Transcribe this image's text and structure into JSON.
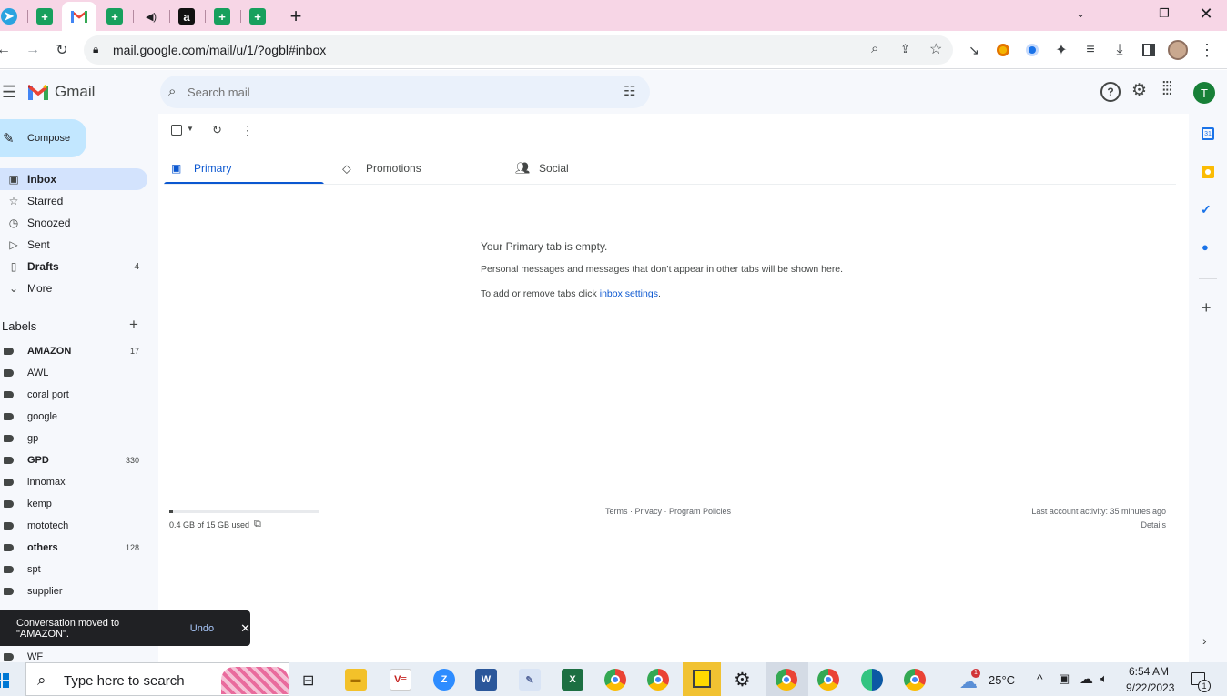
{
  "browser": {
    "tabs": [
      {
        "icon": "telegram-icon",
        "color": "#2aa3e0",
        "glyph": "➤",
        "active": false
      },
      {
        "icon": "sheets-icon",
        "color": "#17a05d",
        "glyph": "+",
        "active": false
      },
      {
        "icon": "gmail-icon",
        "color": "#ea4335",
        "glyph": "M",
        "active": true
      },
      {
        "icon": "sheets-icon",
        "color": "#17a05d",
        "glyph": "+",
        "active": false
      },
      {
        "icon": "audio-icon",
        "color": "#202124",
        "glyph": "◀",
        "active": false
      },
      {
        "icon": "amazon-icon",
        "color": "#111111",
        "glyph": "a",
        "active": false
      },
      {
        "icon": "sheets-icon",
        "color": "#17a05d",
        "glyph": "+",
        "active": false
      },
      {
        "icon": "sheets-icon",
        "color": "#17a05d",
        "glyph": "+",
        "active": false
      }
    ],
    "new_tab": "+",
    "url": "mail.google.com/mail/u/1/?ogbl#inbox"
  },
  "gmail": {
    "logo": "Gmail",
    "search_placeholder": "Search mail",
    "avatar_letter": "T",
    "compose": "Compose",
    "nav": [
      {
        "icon": "inbox-icon",
        "glyph": "▣",
        "label": "Inbox",
        "count": "",
        "bold": true,
        "selected": true
      },
      {
        "icon": "star-icon",
        "glyph": "☆",
        "label": "Starred",
        "count": "",
        "bold": false,
        "selected": false
      },
      {
        "icon": "clock-icon",
        "glyph": "◷",
        "label": "Snoozed",
        "count": "",
        "bold": false,
        "selected": false
      },
      {
        "icon": "send-icon",
        "glyph": "▷",
        "label": "Sent",
        "count": "",
        "bold": false,
        "selected": false
      },
      {
        "icon": "draft-icon",
        "glyph": "▯",
        "label": "Drafts",
        "count": "4",
        "bold": true,
        "selected": false
      },
      {
        "icon": "chevron-down-icon",
        "glyph": "⌄",
        "label": "More",
        "count": "",
        "bold": false,
        "selected": false
      }
    ],
    "labels_heading": "Labels",
    "labels": [
      {
        "label": "AMAZON",
        "count": "17",
        "bold": true
      },
      {
        "label": "AWL",
        "count": "",
        "bold": false
      },
      {
        "label": "coral port",
        "count": "",
        "bold": false
      },
      {
        "label": "google",
        "count": "",
        "bold": false
      },
      {
        "label": "gp",
        "count": "",
        "bold": false
      },
      {
        "label": "GPD",
        "count": "330",
        "bold": true
      },
      {
        "label": "innomax",
        "count": "",
        "bold": false
      },
      {
        "label": "kemp",
        "count": "",
        "bold": false
      },
      {
        "label": "mototech",
        "count": "",
        "bold": false
      },
      {
        "label": "others",
        "count": "128",
        "bold": true
      },
      {
        "label": "spt",
        "count": "",
        "bold": false
      },
      {
        "label": "supplier",
        "count": "",
        "bold": false
      }
    ],
    "last_label": "WF",
    "tabs": [
      {
        "icon": "inbox-icon",
        "label": "Primary"
      },
      {
        "icon": "tag-icon",
        "label": "Promotions"
      },
      {
        "icon": "people-icon",
        "label": "Social"
      }
    ],
    "empty": {
      "title": "Your Primary tab is empty.",
      "desc": "Personal messages and messages that don’t appear in other tabs will be shown here.",
      "settings_prefix": "To add or remove tabs click ",
      "settings_link": "inbox settings",
      "settings_suffix": "."
    },
    "footer": {
      "storage": "0.4 GB of 15 GB used",
      "storage_fraction": 0.027,
      "links": "Terms · Privacy · Program Policies",
      "activity": "Last account activity: 35 minutes ago",
      "details": "Details"
    },
    "snackbar": {
      "message": "Conversation moved to \"AMAZON\".",
      "action": "Undo"
    }
  },
  "taskbar": {
    "search_placeholder": "Type here to search",
    "weather_badge": "1",
    "temp": "25°C",
    "time": "6:54 AM",
    "date": "9/22/2023",
    "notif_count": "1"
  },
  "colors": {
    "accent": "#0b57d0",
    "tab_strip": "#f7d6e6",
    "avatar": "#188038"
  }
}
